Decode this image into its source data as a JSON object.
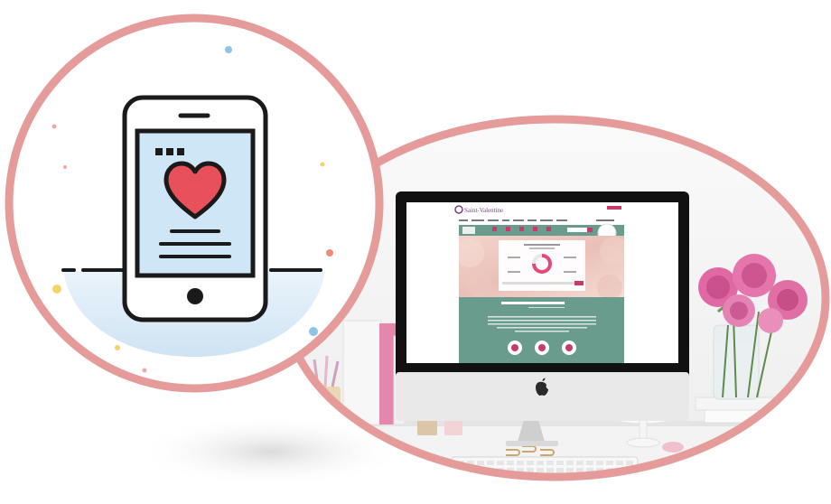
{
  "colors": {
    "ring": "#e69b9b",
    "phone_outline": "#1a1a1a",
    "phone_screen": "#cfe6f7",
    "heart": "#e8505b",
    "water": "#cfe3f3",
    "monitor_bezel": "#111111",
    "site_teal": "#6a9c8d",
    "site_accent": "#c93a6a",
    "rose_pink": "#e06fa0",
    "desk": "#f3f3f3"
  },
  "icons": {
    "left_circle": "phone-heart-icon",
    "logo": "apple-logo-icon"
  },
  "website": {
    "logo_text": "Saint-Valentine"
  }
}
